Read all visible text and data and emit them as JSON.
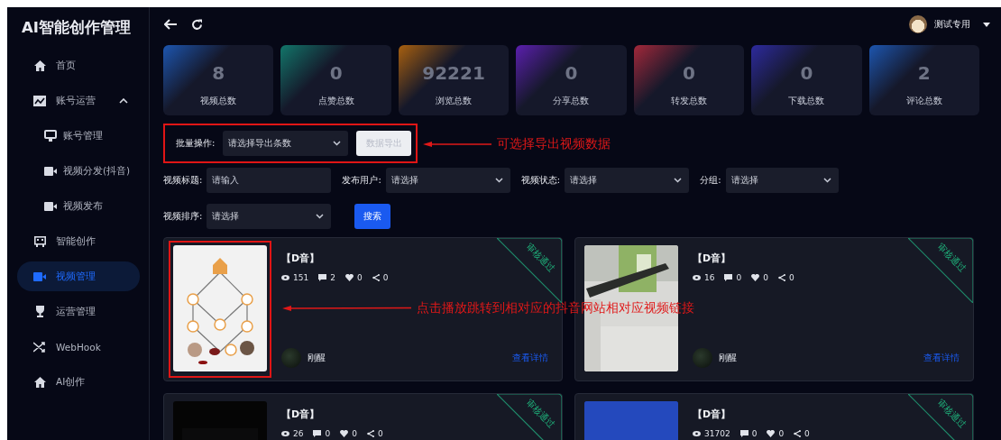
{
  "sidebar": {
    "title": "AI智能创作管理",
    "items": [
      {
        "label": "首页",
        "selected": false
      },
      {
        "label": "账号运营",
        "selected": false,
        "expanded": true,
        "children": [
          {
            "label": "账号管理",
            "selected": false
          },
          {
            "label": "视频分发(抖音)",
            "selected": false
          },
          {
            "label": "视频发布",
            "selected": false
          }
        ]
      },
      {
        "label": "智能创作",
        "selected": false
      },
      {
        "label": "视频管理",
        "selected": true
      },
      {
        "label": "运营管理",
        "selected": false
      },
      {
        "label": "WebHook",
        "selected": false
      },
      {
        "label": "AI创作",
        "selected": false
      }
    ]
  },
  "header": {
    "user": "测试专用"
  },
  "stats": [
    {
      "value": "8",
      "label": "视频总数",
      "color": "#1d56b0"
    },
    {
      "value": "0",
      "label": "点赞总数",
      "color": "#12766a"
    },
    {
      "value": "92221",
      "label": "浏览总数",
      "color": "#a8600f"
    },
    {
      "value": "0",
      "label": "分享总数",
      "color": "#5b1fae"
    },
    {
      "value": "0",
      "label": "转发总数",
      "color": "#a3283a"
    },
    {
      "value": "0",
      "label": "下载总数",
      "color": "#2d2a9e"
    },
    {
      "value": "2",
      "label": "评论总数",
      "color": "#1d56b0"
    }
  ],
  "batch": {
    "label": "批量操作:",
    "select": {
      "placeholder": "请选择导出条数"
    },
    "button": {
      "label": "数据导出",
      "disabled": true
    },
    "highlighted": true
  },
  "filters": [
    {
      "label": "视频标题:",
      "kind": "input",
      "placeholder": "请输入"
    },
    {
      "label": "发布用户:",
      "kind": "select",
      "placeholder": "请选择"
    },
    {
      "label": "视频状态:",
      "kind": "select",
      "placeholder": "请选择"
    },
    {
      "label": "分组:",
      "kind": "select",
      "placeholder": "请选择"
    },
    {
      "label": "视频排序:",
      "kind": "select",
      "placeholder": "请选择"
    }
  ],
  "search_button": "搜索",
  "videos": [
    {
      "title": "【D音】",
      "views": "151",
      "comments": "2",
      "likes": "0",
      "shares": "0",
      "author": "刚醒",
      "link": "查看详情",
      "status": "审核通过",
      "highlighted": true
    },
    {
      "title": "【D音】",
      "views": "16",
      "comments": "0",
      "likes": "0",
      "shares": "0",
      "author": "刚醒",
      "link": "查看详情",
      "status": "审核通过",
      "highlighted": false
    },
    {
      "title": "【D音】",
      "views": "26",
      "comments": "0",
      "likes": "0",
      "shares": "0",
      "status": "审核通过",
      "highlighted": false
    },
    {
      "title": "【D音】",
      "views": "31702",
      "comments": "0",
      "likes": "0",
      "shares": "0",
      "status": "审核通过",
      "highlighted": false
    }
  ],
  "annotations": [
    "可选择导出视频数据",
    "点击播放跳转到相对应的抖音网站相对应视频链接"
  ]
}
